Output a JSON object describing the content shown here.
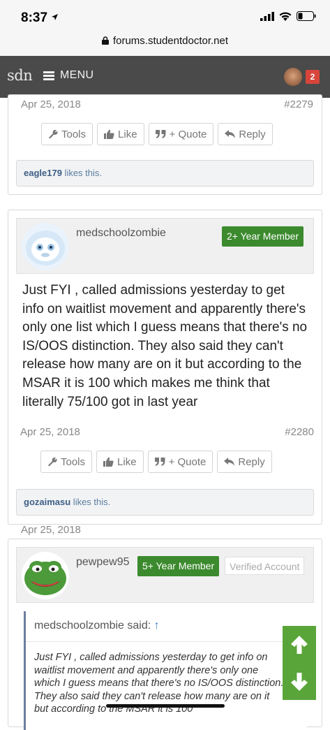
{
  "status": {
    "time": "8:37"
  },
  "browser": {
    "url": "forums.studentdoctor.net"
  },
  "nav": {
    "logo": "sdn",
    "menu_label": "MENU",
    "notification_count": "2"
  },
  "actions": {
    "tools": "Tools",
    "like": "Like",
    "quote": "+ Quote",
    "reply": "Reply"
  },
  "posts": [
    {
      "date": "Apr 25, 2018",
      "number": "#2279",
      "likes_user": "eagle179",
      "likes_text": " likes this."
    },
    {
      "author": "medschoolzombie",
      "member_badge": "2+ Year Member",
      "body": "Just FYI , called admissions yesterday to get info on waitlist movement and apparently there's only one list which I guess means that there's no IS/OOS distinction. They also said they can't release how many are on it but according to the MSAR it is 100 which makes me think that literally 75/100 got in last year",
      "date": "Apr 25, 2018",
      "number": "#2280",
      "likes_user": "gozaimasu",
      "likes_text": " likes this."
    },
    {
      "author": "pewpew95",
      "member_badge": "5+ Year Member",
      "verified": "Verified Account",
      "quote_author": "medschoolzombie said:",
      "quote_arrow": "↑",
      "quote_body": "Just FYI , called admissions yesterday to get info on waitlist movement and apparently there's only one which I guess means that there's no IS/OOS distinction. They also said they can't release how many are on it but according to the MSAR it is 100"
    }
  ]
}
